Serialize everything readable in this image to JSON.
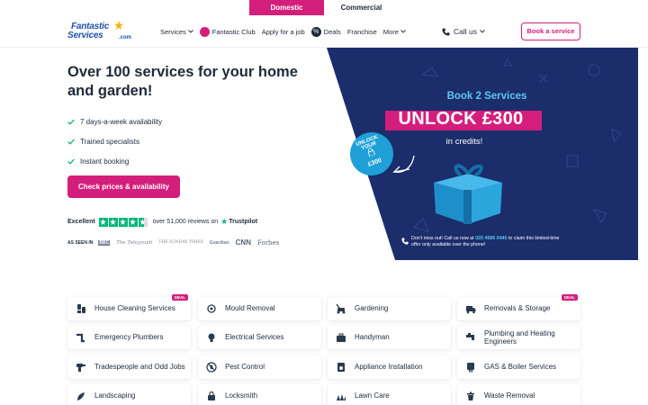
{
  "segments": {
    "domestic": "Domestic",
    "commercial": "Commercial"
  },
  "logo": {
    "line1": "Fantastic",
    "line2": "Services",
    "suffix": ".com"
  },
  "nav": {
    "services": "Services",
    "club": "Fantastic Club",
    "apply": "Apply for a job",
    "deals": "Deals",
    "franchise": "Franchise",
    "more": "More",
    "call": "Call us",
    "book": "Book a service"
  },
  "hero": {
    "title": "Over 100 services for your home and garden!",
    "features": [
      "7 days-a-week availability",
      "Trained specialists",
      "Instant booking"
    ],
    "cta": "Check prices & availability"
  },
  "trust": {
    "rating": "Excellent",
    "reviews": "over 51,000 reviews on",
    "brand": "Trustpilot"
  },
  "seen_in": {
    "label": "AS SEEN IN",
    "outlets": [
      "BBC",
      "The Telegraph",
      "THE SUNDAY TIMES",
      "Guardian",
      "CNN",
      "Forbes"
    ]
  },
  "promo": {
    "title": "Book 2 Services",
    "unlock": "UNLOCK £300",
    "credits": "in credits!",
    "badge_top": "UNLOCK YOUR",
    "badge_bottom": "£300",
    "note_pre": "Don't miss out! Call us now at ",
    "phone": "020 4586 0445",
    "note_post": " to claim this limited-time offer only available over the phone!"
  },
  "deal_label": "DEAL",
  "services": [
    {
      "label": "House Cleaning Services",
      "icon": "cleaning-icon",
      "deal": true
    },
    {
      "label": "Mould Removal",
      "icon": "mould-icon",
      "deal": false
    },
    {
      "label": "Gardening",
      "icon": "lawnmower-icon",
      "deal": false
    },
    {
      "label": "Removals & Storage",
      "icon": "van-icon",
      "deal": true
    },
    {
      "label": "Emergency Plumbers",
      "icon": "pipe-icon",
      "deal": false
    },
    {
      "label": "Electrical Services",
      "icon": "bulb-icon",
      "deal": false
    },
    {
      "label": "Handyman",
      "icon": "toolbox-icon",
      "deal": false
    },
    {
      "label": "Plumbing and Heating Engineers",
      "icon": "tap-icon",
      "deal": false
    },
    {
      "label": "Tradespeople and Odd Jobs",
      "icon": "drill-icon",
      "deal": false
    },
    {
      "label": "Pest Control",
      "icon": "pest-icon",
      "deal": false
    },
    {
      "label": "Appliance Installation",
      "icon": "appliance-icon",
      "deal": false
    },
    {
      "label": "GAS & Boiler Services",
      "icon": "boiler-icon",
      "deal": false
    },
    {
      "label": "Landscaping",
      "icon": "landscaping-icon",
      "deal": false
    },
    {
      "label": "Locksmith",
      "icon": "locksmith-icon",
      "deal": false
    },
    {
      "label": "Lawn Care",
      "icon": "lawn-icon",
      "deal": false
    },
    {
      "label": "Waste Removal",
      "icon": "bin-icon",
      "deal": false
    }
  ],
  "colors": {
    "brand": "#d41e7c",
    "navy": "#1b2d6b",
    "accent": "#5bc8f2",
    "trustpilot": "#00b67a"
  }
}
